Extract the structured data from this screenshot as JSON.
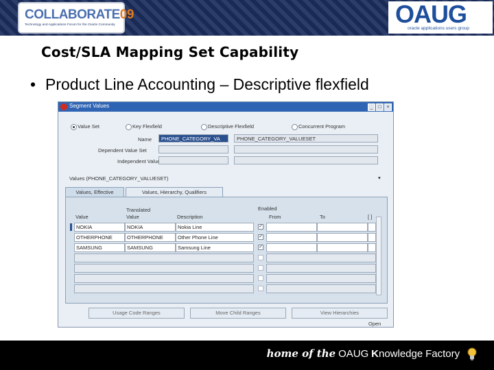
{
  "header": {
    "left_logo_name": "COLLABORATE",
    "left_logo_year": "09",
    "left_logo_tagline": "Technology and Applications Forum for the Oracle Community",
    "right_logo_name": "OAUG",
    "right_logo_tagline": "oracle applications users group",
    "colors": {
      "banner": "#1a2d5c",
      "accent_orange": "#e07a1e",
      "oaug_blue": "#1e4f9c"
    }
  },
  "slide": {
    "title": "Cost/SLA Mapping Set Capability",
    "bullet_glyph": "•",
    "bullet": "Product Line Accounting – Descriptive flexfield"
  },
  "form": {
    "window_title": "Segment Values",
    "titlebar_buttons": [
      "_",
      "□",
      "×"
    ],
    "radios": [
      {
        "label": "Value Set",
        "selected": true
      },
      {
        "label": "Key Flexfield",
        "selected": false
      },
      {
        "label": "Descriptive Flexfield",
        "selected": false
      },
      {
        "label": "Concurrent Program",
        "selected": false
      }
    ],
    "fields": {
      "name_label": "Name",
      "name_value": "PHONE_CATEGORY_VA",
      "name_desc": "PHONE_CATEGORY_VALUESET",
      "dependent_label": "Dependent Value Set",
      "independent_label": "Independent Value"
    },
    "values_section": "Values (PHONE_CATEGORY_VALUESET)",
    "tabs": [
      "Values, Effective",
      "Values, Hierarchy, Qualifiers"
    ],
    "columns": {
      "value": "Value",
      "translated_top": "Translated",
      "translated_bottom": "Value",
      "description": "Description",
      "enabled": "Enabled",
      "from": "From",
      "to": "To",
      "bracket": "[ ]"
    },
    "rows": [
      {
        "value": "NOKIA",
        "translated": "NOKIA",
        "description": "Nokia Line",
        "enabled": "✓"
      },
      {
        "value": "OTHERPHONE",
        "translated": "OTHERPHONE",
        "description": "Other Phone Line",
        "enabled": "✓"
      },
      {
        "value": "SAMSUNG",
        "translated": "SAMSUNG",
        "description": "Samsung Line",
        "enabled": "✓"
      }
    ],
    "buttons": [
      "Usage Code Ranges",
      "Move Child Ranges",
      "View Hierarchies"
    ],
    "open_label": "Open"
  },
  "footer": {
    "script_text": "home of the",
    "org": "OAUG",
    "knowledge_cap": "K",
    "knowledge_rest": "nowledge",
    "factory": "Factory"
  }
}
